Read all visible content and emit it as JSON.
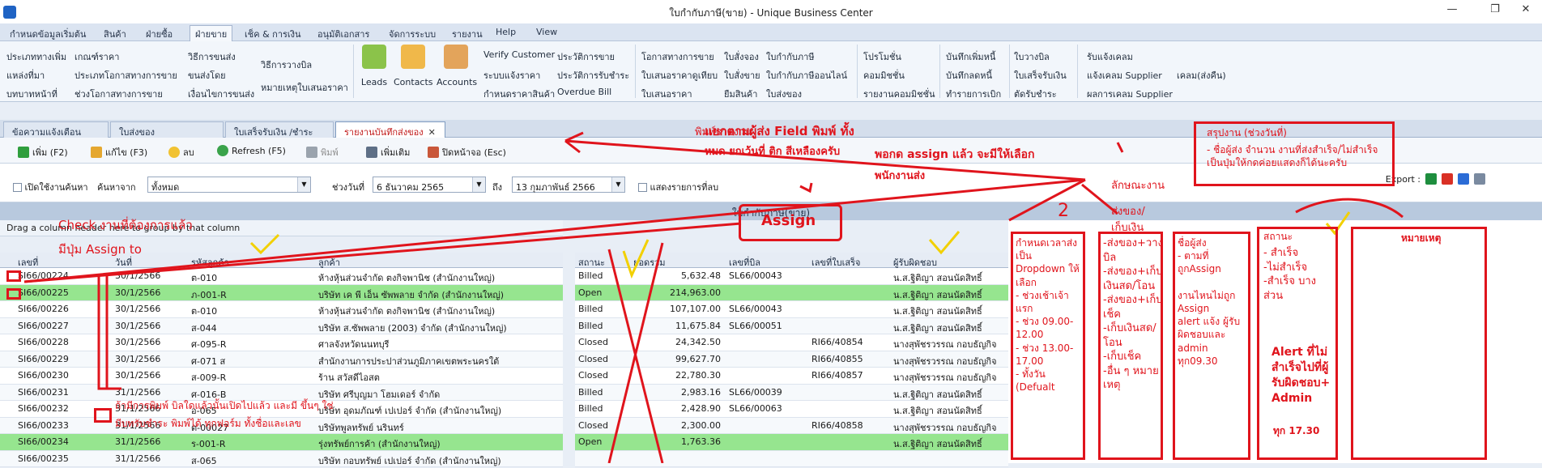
{
  "window": {
    "title": "ใบกำกับภาษี(ขาย) - Unique Business Center"
  },
  "menu": [
    "กำหนดข้อมูลเริ่มต้น",
    "สินค้า",
    "ฝ่ายซื้อ",
    "ฝ่ายขาย",
    "เช็ค & การเงิน",
    "อนุมัติเอกสาร",
    "จัดการระบบ",
    "รายงาน",
    "Help",
    "View"
  ],
  "ribbon": {
    "col1": [
      "ประเภททางเพิ่ม",
      "แหล่งที่มา",
      "บทบาทหน้าที่"
    ],
    "col2": [
      "เกณฑ์ราคา",
      "ประเภทโอกาสทางการขาย",
      "ช่วงโอกาสทางการขาย"
    ],
    "col3": [
      "วิธีการขนส่ง",
      "ขนส่งโดย",
      "เงื่อนไขการขนส่ง"
    ],
    "col4": [
      "วิธีการวางบิล",
      "หมายเหตุใบเสนอราคา"
    ],
    "big": [
      "Leads",
      "Contacts",
      "Accounts"
    ],
    "col5": [
      "Verify Customer",
      "ระบบแจ้งราคา",
      "กำหนดราคาสินค้า"
    ],
    "col6": [
      "ประวัติการขาย",
      "ประวัติการรับชำระ",
      "Overdue Bill"
    ],
    "col7": [
      "โอกาสทางการขาย",
      "ใบเสนอราคาดูเทียบ",
      "ใบเสนอราคา"
    ],
    "col8": [
      "ใบสั่งจอง",
      "ใบสั่งขาย",
      "ยืมสินค้า"
    ],
    "col9": [
      "ใบกำกับภาษี",
      "ใบกำกับภาษีออนไลน์",
      "ใบส่งของ"
    ],
    "col10": [
      "โปรโมชั่น",
      "คอมมิชชั่น",
      "รายงานคอมมิชชั่น"
    ],
    "col11": [
      "บันทึกเพิ่มหนี้",
      "บันทึกลดหนี้",
      "ทำรายการเบิก"
    ],
    "col12": [
      "ใบวางบิล",
      "ใบเสร็จรับเงิน",
      "ตัดรับชำระ"
    ],
    "col13": [
      "รับแจ้งเคลม",
      "แจ้งเคลม Supplier",
      "ผลการเคลม Supplier"
    ],
    "col14": [
      "เคลม(ส่งคืน)"
    ]
  },
  "doctabs": [
    "ข้อความแจ้งเตือน",
    "ใบส่งของ",
    "ใบเสร็จรับเงิน /ชำระเงิน",
    "รายงานบันทึกส่งของ"
  ],
  "toolbar": {
    "add": "เพิ่ม (F2)",
    "edit": "แก้ไข (F3)",
    "delete": "ลบ",
    "refresh": "Refresh (F5)",
    "print": "พิมพ์",
    "more": "เพิ่มเติม",
    "close": "ปิดหน้าจอ (Esc)"
  },
  "filters": {
    "open_search": "เปิดใช้งานค้นหา",
    "search_from": "ค้นหาจาก",
    "search_value": "ทั้งหมด",
    "period": "ช่วงวันที่",
    "date_from": "6 ธันวาคม 2565",
    "to": "ถึง",
    "date_to": "13 กุมภาพันธ์ 2566",
    "show_deleted": "แสดงรายการที่ลบ",
    "export": "Export :"
  },
  "group_title": "ใบกำกับภาษี(ขาย)",
  "drag_hint": "Drag a column header here to group by that column",
  "left_headers": [
    "เลขที่",
    "วันที่",
    "รหัสลูกค้า",
    "ลูกค้า"
  ],
  "right_headers": [
    "สถานะ",
    "ยอดรวม",
    "เลขที่บิล",
    "เลขที่ใบเสร็จ",
    "ผู้รับผิดชอบ"
  ],
  "rows": [
    {
      "no": "SI66/00224",
      "date": "30/1/2566",
      "code": "ต-010",
      "cust": "ห้างหุ้นส่วนจำกัด ตงกิจพานิช (สำนักงานใหญ่)",
      "status": "Billed",
      "total": "5,632.48",
      "bill": "SL66/00043",
      "rec": "",
      "owner": "น.ส.ฐิติญา สอนนัดสิทธิ์",
      "green": false
    },
    {
      "no": "SI66/00225",
      "date": "30/1/2566",
      "code": "ภ-001-R",
      "cust": "บริษัท เค พี เอ็น ซัพพลาย จำกัด (สำนักงานใหญ่)",
      "status": "Open",
      "total": "214,963.00",
      "bill": "",
      "rec": "",
      "owner": "น.ส.ฐิติญา สอนนัดสิทธิ์",
      "green": true
    },
    {
      "no": "SI66/00226",
      "date": "30/1/2566",
      "code": "ต-010",
      "cust": "ห้างหุ้นส่วนจำกัด ตงกิจพานิช (สำนักงานใหญ่)",
      "status": "Billed",
      "total": "107,107.00",
      "bill": "SL66/00043",
      "rec": "",
      "owner": "น.ส.ฐิติญา สอนนัดสิทธิ์",
      "green": false
    },
    {
      "no": "SI66/00227",
      "date": "30/1/2566",
      "code": "ส-044",
      "cust": "บริษัท ส.ซัพพลาย (2003) จำกัด (สำนักงานใหญ่)",
      "status": "Billed",
      "total": "11,675.84",
      "bill": "SL66/00051",
      "rec": "",
      "owner": "น.ส.ฐิติญา สอนนัดสิทธิ์",
      "green": false
    },
    {
      "no": "SI66/00228",
      "date": "30/1/2566",
      "code": "ศ-095-R",
      "cust": "ศาลจังหวัดนนทบุรี",
      "status": "Closed",
      "total": "24,342.50",
      "bill": "",
      "rec": "RI66/40854",
      "owner": "นางสุพัชรวรรณ กอบธัญกิจ",
      "green": false
    },
    {
      "no": "SI66/00229",
      "date": "30/1/2566",
      "code": "ศ-071 ส",
      "cain": "",
      "cust": "สำนักงานการประปาส่วนภูมิภาคเขตพระนครใต้",
      "status": "Closed",
      "total": "99,627.70",
      "bill": "",
      "rec": "RI66/40855",
      "owner": "นางสุพัชรวรรณ กอบธัญกิจ",
      "green": false
    },
    {
      "no": "SI66/00230",
      "date": "30/1/2566",
      "code": "ส-009-R",
      "cust": "ร้าน สวัสดีไอสต",
      "status": "Closed",
      "total": "22,780.30",
      "bill": "",
      "rec": "RI66/40857",
      "owner": "นางสุพัชรวรรณ กอบธัญกิจ",
      "green": false
    },
    {
      "no": "SI66/00231",
      "date": "31/1/2566",
      "code": "ศ-016-B",
      "cust": "บริษัท ศรีบุญมา โฮมเดอร์ จำกัด",
      "status": "Billed",
      "total": "2,983.16",
      "bill": "SL66/00039",
      "rec": "",
      "owner": "น.ส.ฐิติญา สอนนัดสิทธิ์",
      "green": false
    },
    {
      "no": "SI66/00232",
      "date": "31/1/2566",
      "code": "อ-065",
      "cust": "บริษัท อุดมภัณฑ์ เปเปอร์ จำกัด (สำนักงานใหญ่)",
      "status": "Billed",
      "total": "2,428.90",
      "bill": "SL66/00063",
      "rec": "",
      "owner": "น.ส.ฐิติญา สอนนัดสิทธิ์",
      "green": false
    },
    {
      "no": "SI66/00233",
      "date": "31/1/2566",
      "code": "ต-00027",
      "cust": "บริษัทพูลทรัพย์ นรินทร์",
      "status": "Closed",
      "total": "2,300.00",
      "bill": "",
      "rec": "RI66/40858",
      "owner": "นางสุพัชรวรรณ กอบธัญกิจ",
      "green": false
    },
    {
      "no": "SI66/00234",
      "date": "31/1/2566",
      "code": "ร-001-R",
      "cust": "รุ่งทรัพย์การค้า (สำนักงานใหญ่)",
      "status": "Open",
      "total": "1,763.36",
      "bill": "",
      "rec": "",
      "owner": "น.ส.ฐิติญา สอนนัดสิทธิ์",
      "green": true
    },
    {
      "no": "SI66/00235",
      "date": "31/1/2566",
      "code": "ส-065",
      "cust": "บริษัท กอบทรัพย์ เปเปอร์ จำกัด (สำนักงานใหญ่)",
      "status": "",
      "total": "",
      "bill": "",
      "rec": "",
      "owner": "",
      "green": false
    }
  ],
  "annotations": {
    "print_note": "พิมพ์รายงาน",
    "field_note_1": "แยกตามผู้ส่ง Field พิมพ์ ทั้ง",
    "field_note_2": "หมด ยกเว้นที่ ติก สีเหลืองครับ",
    "assign_note_1": "พอกด assign แล้ว จะมีให้เลือก",
    "assign_note_2": "พนักงานส่ง",
    "summary_title": "สรุปงาน (ช่วงวันที่)",
    "summary_1": "- ชื่อผู้ส่ง จำนวน งานที่ส่งสำเร็จ/ไม่สำเร็จ",
    "summary_2": "เป็นปุ่มให้กดค่อยแสดงก็ได้นะครับ",
    "assign_button": "Assign",
    "check_note": "Check งานที่ต้องการแล้ว",
    "check_note_2": "มีปุ่ม Assign to",
    "print_row_note_1": "ถ้ามีการพิมพ์ บิลใดแล้วนั้นเปิดไปแล้ว และมี ขึ้นๆ ใช่",
    "print_row_note_2": "มีบทรับชำระ พิมพ์ได้ ทุกฟอร์ม ทั้งชื่อและเลข",
    "num2": "2",
    "col_type_1": "ลักษณะงาน",
    "col_type_2": "ส่งของ/",
    "col_type_3": "เก็บเงิน",
    "box1": "กำหนดเวลาส่ง\nเป็น\nDropdown ให้\nเลือก\n- ช่วงเช้าเจ้าแรก\n- ช่วง 09.00-12.00\n- ช่วง 13.00-17.00\n- ทั้งวัน (Defualt",
    "box2": "-ส่งของ+วาง\nบิล\n-ส่งของ+เก็บ\nเงินสด/โอน\n-ส่งของ+เก็บ\nเช็ค\n-เก็บเงินสด/\nโอน\n-เก็บเช็ค\n-อื่น ๆ หมาย\nเหตุ",
    "box3": "ชื่อผู้ส่ง\n- ตามที่\nถูกAssign\n\nงานไหนไม่ถูก\nAssign\nalert แจ้ง ผู้รับ\nผิดชอบและ\nadmin\nทุก09.30",
    "box4_title": "สถานะ",
    "box4": "- สำเร็จ\n-ไม่สำเร็จ\n-สำเร็จ บาง\nส่วน",
    "box4_alert": "Alert ที่ไม่\nสำเร็จไปที่ผู้\nรับผิดชอบ+\nAdmin",
    "box4_time": "ทุก 17.30",
    "box5": "หมายเหตุ"
  }
}
